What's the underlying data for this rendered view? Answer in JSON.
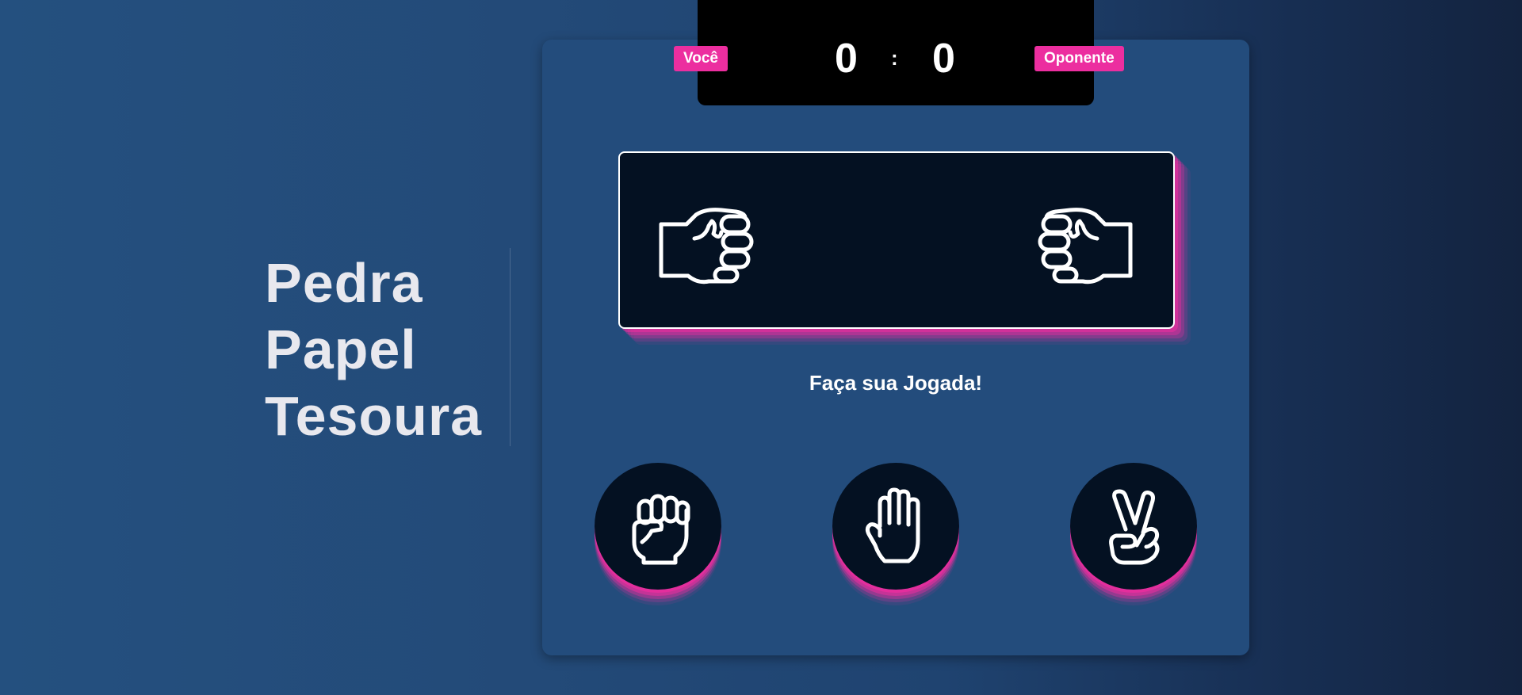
{
  "title": {
    "line1": "Pedra",
    "line2": "Papel",
    "line3": "Tesoura"
  },
  "scoreboard": {
    "player_label": "Você",
    "opponent_label": "Oponente",
    "player_score": "0",
    "separator": ":",
    "opponent_score": "0"
  },
  "arena": {
    "player_hand_icon": "fist-icon",
    "opponent_hand_icon": "fist-icon"
  },
  "prompt": "Faça sua Jogada!",
  "choices": [
    {
      "id": "pedra",
      "icon": "rock-fist-icon"
    },
    {
      "id": "papel",
      "icon": "paper-hand-icon"
    },
    {
      "id": "tesoura",
      "icon": "scissors-hand-icon"
    }
  ],
  "colors": {
    "accent": "#ec2e9f",
    "panel": "#234c7c",
    "dark": "#041122"
  }
}
